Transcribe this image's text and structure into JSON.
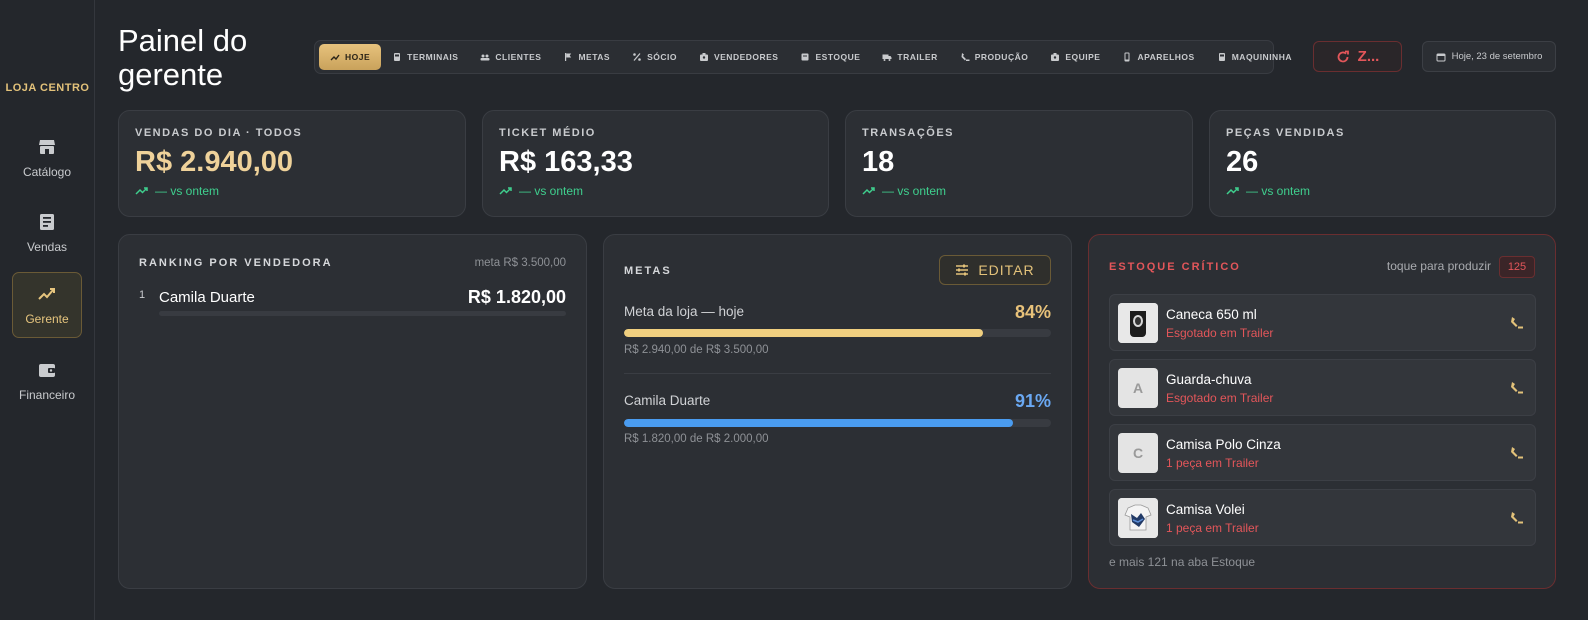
{
  "sidebar": {
    "store_name": "LOJA CENTRO",
    "items": [
      {
        "label": "Catálogo",
        "icon": "storefront-icon"
      },
      {
        "label": "Vendas",
        "icon": "receipt-icon"
      },
      {
        "label": "Gerente",
        "icon": "trending-up-icon",
        "active": true
      },
      {
        "label": "Financeiro",
        "icon": "wallet-icon"
      }
    ]
  },
  "header": {
    "title": "Painel do gerente",
    "tabs": [
      {
        "label": "HOJE",
        "icon": "trending-up-icon",
        "active": true
      },
      {
        "label": "TERMINAIS",
        "icon": "terminal-icon"
      },
      {
        "label": "CLIENTES",
        "icon": "people-icon"
      },
      {
        "label": "METAS",
        "icon": "flag-icon"
      },
      {
        "label": "SÓCIO",
        "icon": "percent-icon"
      },
      {
        "label": "VENDEDORES",
        "icon": "badge-icon"
      },
      {
        "label": "ESTOQUE",
        "icon": "box-icon"
      },
      {
        "label": "TRAILER",
        "icon": "truck-icon"
      },
      {
        "label": "PRODUÇÃO",
        "icon": "production-icon"
      },
      {
        "label": "EQUIPE",
        "icon": "team-icon"
      },
      {
        "label": "APARELHOS",
        "icon": "device-icon"
      },
      {
        "label": "MAQUININHA",
        "icon": "card-machine-icon"
      }
    ],
    "refresh_label": "Z...",
    "date_label": "Hoje, 23 de setembro"
  },
  "kpis": [
    {
      "label": "VENDAS DO DIA · TODOS",
      "value": "R$ 2.940,00",
      "trend": "— vs ontem"
    },
    {
      "label": "TICKET MÉDIO",
      "value": "R$ 163,33",
      "trend": "— vs ontem"
    },
    {
      "label": "TRANSAÇÕES",
      "value": "18",
      "trend": "— vs ontem"
    },
    {
      "label": "PEÇAS VENDIDAS",
      "value": "26",
      "trend": "— vs ontem"
    }
  ],
  "ranking": {
    "title": "RANKING POR VENDEDORA",
    "meta": "meta R$ 3.500,00",
    "rows": [
      {
        "rank": "1",
        "name": "Camila Duarte",
        "value": "R$ 1.820,00"
      }
    ]
  },
  "metas": {
    "title": "METAS",
    "edit_label": "EDITAR",
    "goals": [
      {
        "name": "Meta da loja — hoje",
        "pct_label": "84%",
        "progress": 0.84,
        "sub": "R$ 2.940,00 de R$ 3.500,00",
        "color": "#f0cf7f",
        "pct_color": "#e8c27a"
      },
      {
        "name": "Camila Duarte",
        "pct_label": "91%",
        "progress": 0.91,
        "sub": "R$ 1.820,00 de R$ 2.000,00",
        "color": "#4a9cf0",
        "pct_color": "#6aa8f2"
      }
    ]
  },
  "estoque": {
    "title": "ESTOQUE CRÍTICO",
    "hint": "toque para produzir",
    "badge": "125",
    "items": [
      {
        "name": "Caneca 650 ml",
        "status": "Esgotado em Trailer",
        "thumb": "mug-image",
        "letter": ""
      },
      {
        "name": "Guarda-chuva",
        "status": "Esgotado em Trailer",
        "thumb": "placeholder",
        "letter": "A"
      },
      {
        "name": "Camisa Polo Cinza",
        "status": "1 peça em Trailer",
        "thumb": "placeholder",
        "letter": "C"
      },
      {
        "name": "Camisa Volei",
        "status": "1 peça em Trailer",
        "thumb": "shirt-image",
        "letter": ""
      }
    ],
    "more": "e mais 121 na aba Estoque"
  }
}
